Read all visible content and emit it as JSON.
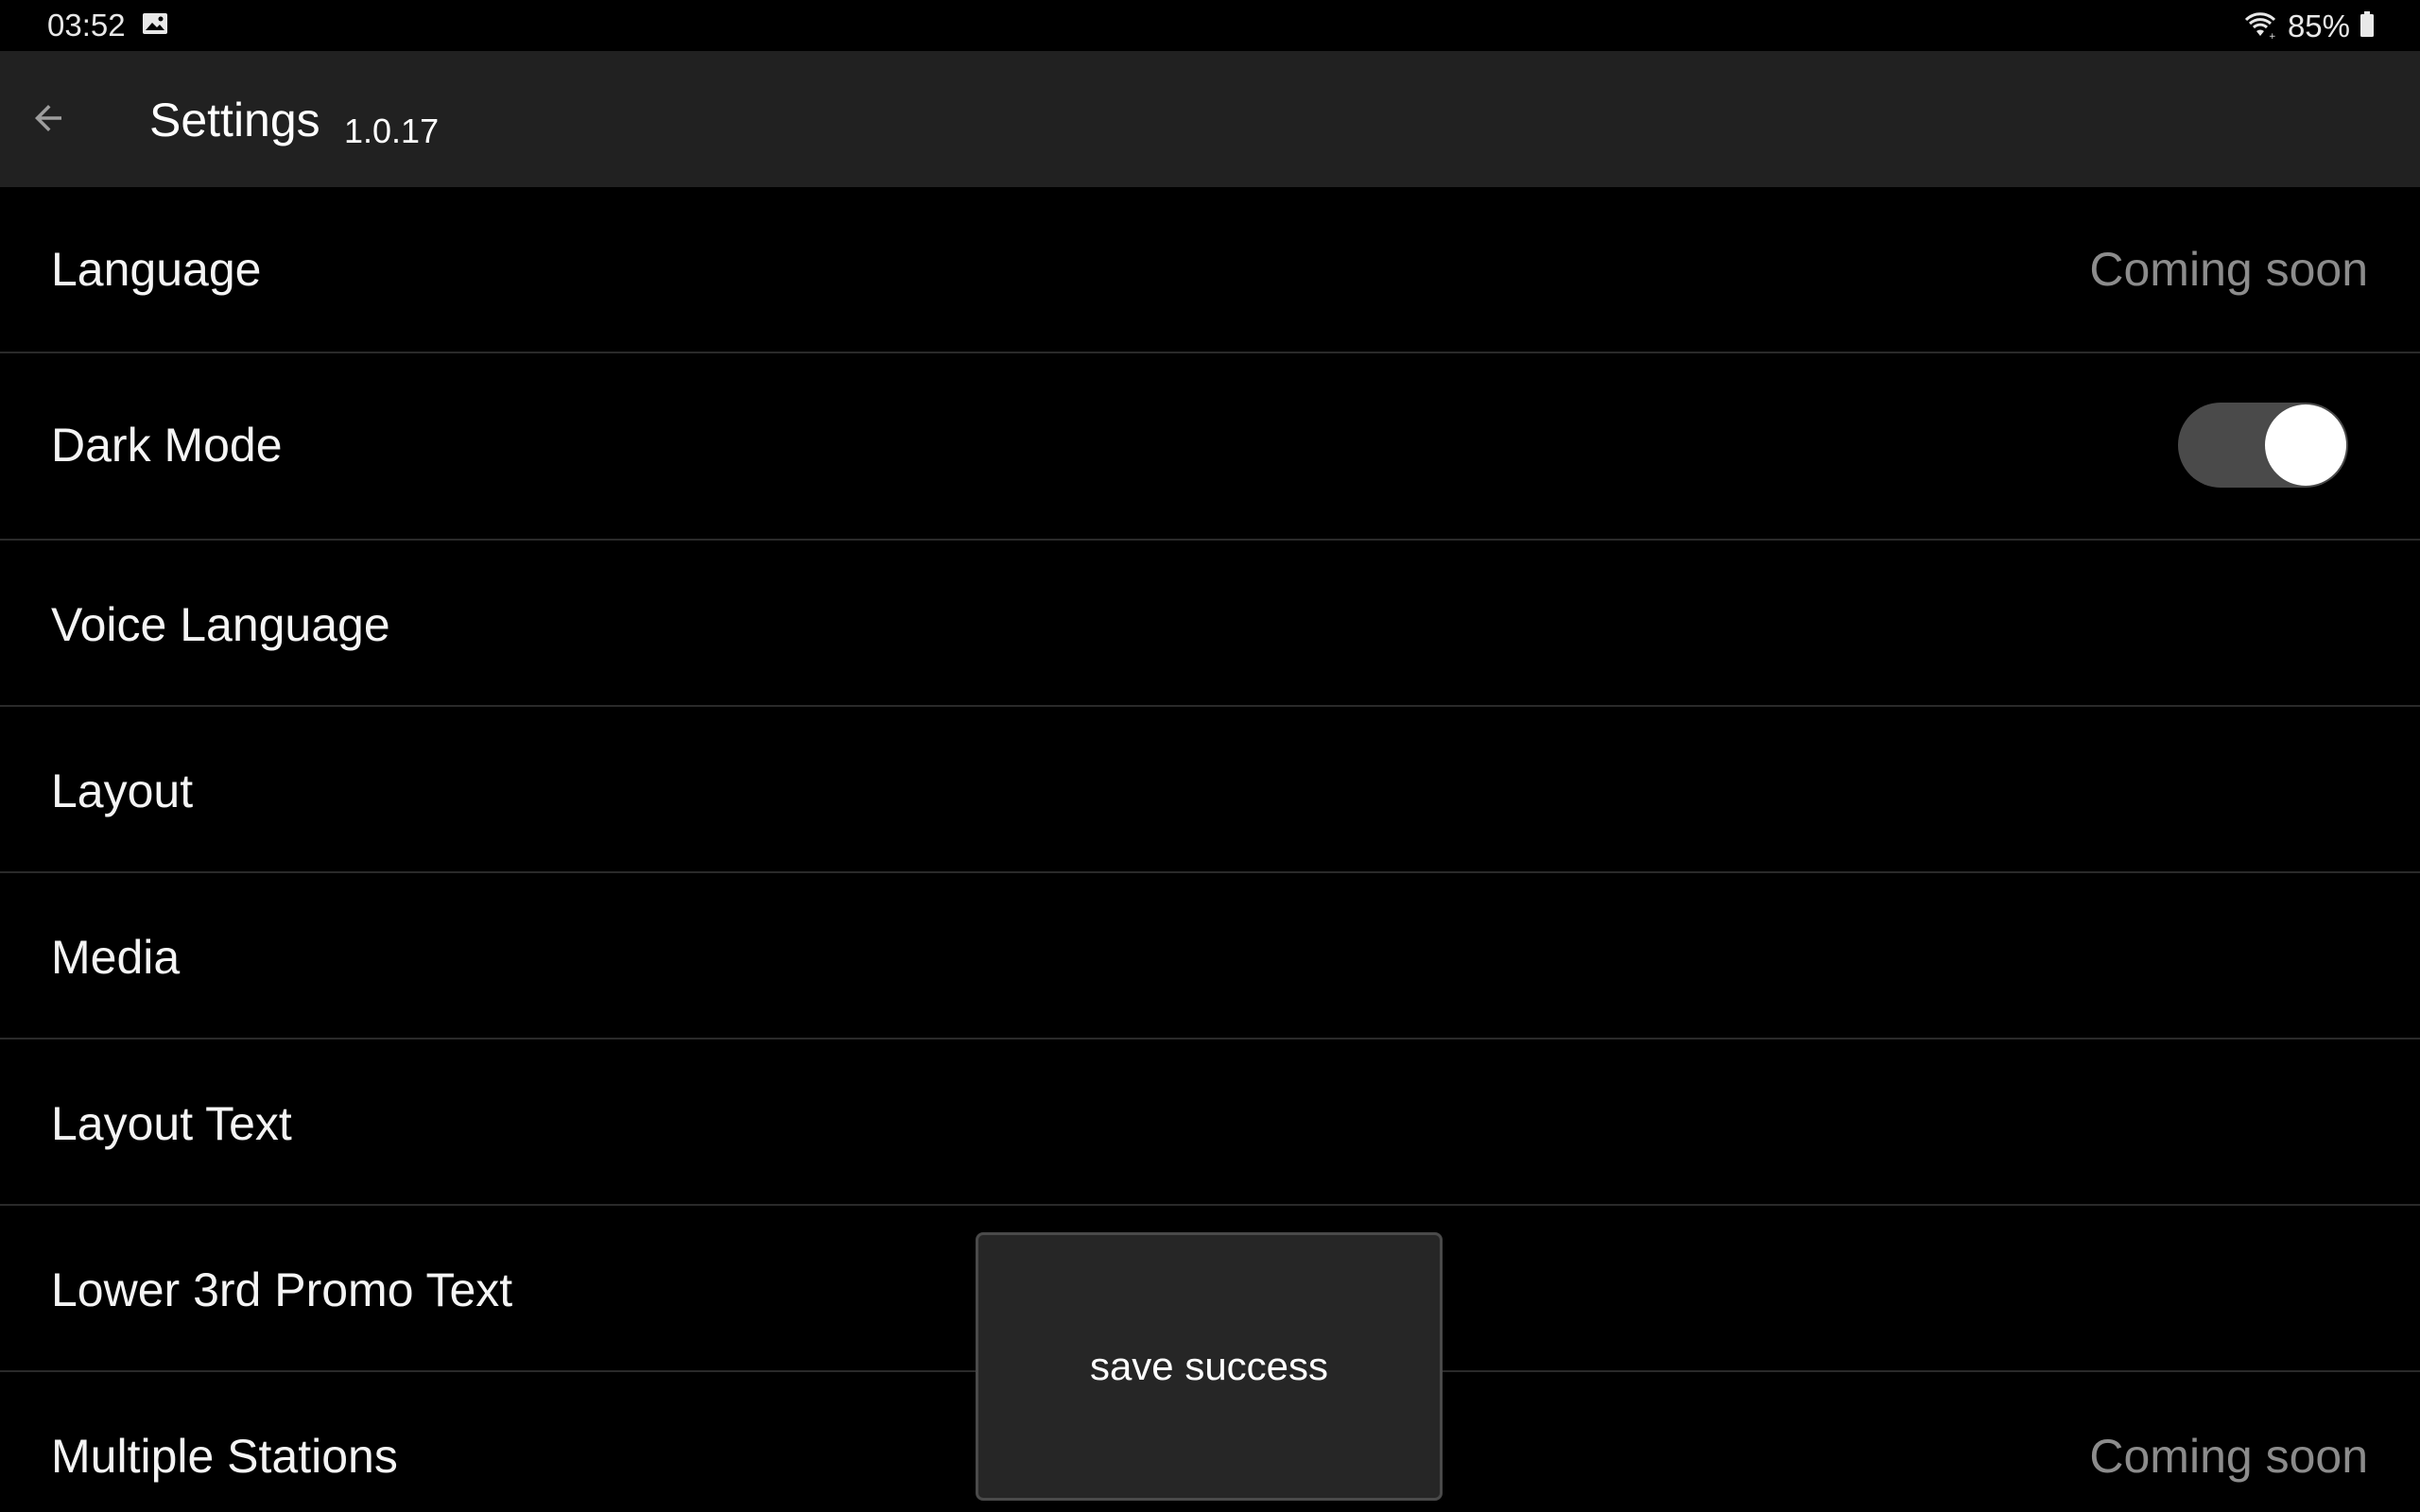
{
  "status_bar": {
    "time": "03:52",
    "battery": "85%",
    "icons": [
      "image-icon",
      "wifi-icon",
      "battery-icon"
    ]
  },
  "app_bar": {
    "title": "Settings",
    "version": "1.0.17",
    "back_icon": "arrow-left-icon"
  },
  "settings": {
    "language": {
      "label": "Language",
      "value": "Coming soon"
    },
    "dark_mode": {
      "label": "Dark Mode",
      "enabled": true
    },
    "voice_language": {
      "label": "Voice Language"
    },
    "layout": {
      "label": "Layout"
    },
    "media": {
      "label": "Media"
    },
    "layout_text": {
      "label": "Layout Text"
    },
    "lower_3rd": {
      "label": "Lower 3rd Promo Text"
    },
    "multiple_stations": {
      "label": "Multiple Stations",
      "value": "Coming soon"
    }
  },
  "toast": {
    "message": "save success"
  },
  "colors": {
    "background": "#000000",
    "app_bar": "#212121",
    "divider": "#2a2a2a",
    "secondary_text": "#8c8c8c",
    "toggle_track": "#4a4a4a",
    "toast_bg": "#262626"
  }
}
